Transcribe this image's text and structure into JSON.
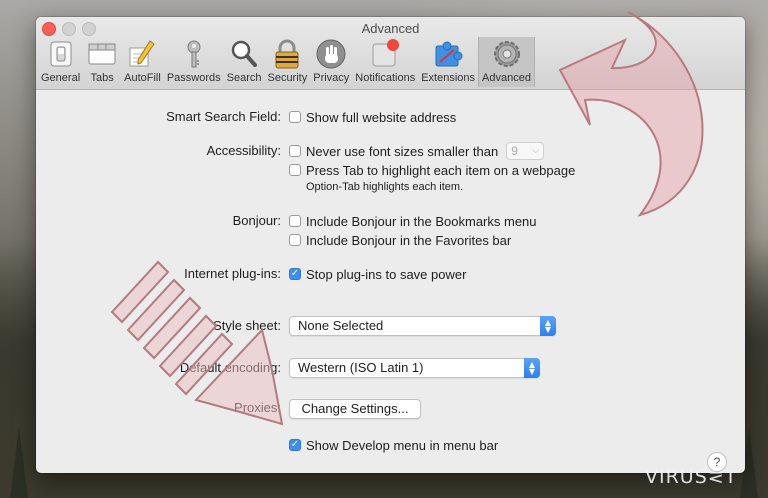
{
  "window": {
    "title": "Advanced"
  },
  "toolbar": {
    "items": [
      {
        "label": "General",
        "icon": "general-switch-icon"
      },
      {
        "label": "Tabs",
        "icon": "tabs-icon"
      },
      {
        "label": "AutoFill",
        "icon": "pencil-form-icon"
      },
      {
        "label": "Passwords",
        "icon": "key-icon"
      },
      {
        "label": "Search",
        "icon": "magnifier-icon"
      },
      {
        "label": "Security",
        "icon": "padlock-icon"
      },
      {
        "label": "Privacy",
        "icon": "hand-icon"
      },
      {
        "label": "Notifications",
        "icon": "notifications-icon"
      },
      {
        "label": "Extensions",
        "icon": "puzzle-icon"
      },
      {
        "label": "Advanced",
        "icon": "gear-icon"
      }
    ],
    "selected": "Advanced"
  },
  "settings": {
    "smart_search": {
      "label": "Smart Search Field:",
      "option": "Show full website address",
      "checked": false
    },
    "accessibility": {
      "label": "Accessibility:",
      "option1": "Never use font sizes smaller than",
      "font_size": "9",
      "option2": "Press Tab to highlight each item on a webpage",
      "note": "Option-Tab highlights each item."
    },
    "bonjour": {
      "label": "Bonjour:",
      "option1": "Include Bonjour in the Bookmarks menu",
      "option2": "Include Bonjour in the Favorites bar"
    },
    "plugins": {
      "label": "Internet plug-ins:",
      "option": "Stop plug-ins to save power",
      "checked": true
    },
    "style_sheet": {
      "label": "Style sheet:",
      "value": "None Selected"
    },
    "encoding": {
      "label": "Default encoding:",
      "value": "Western (ISO Latin 1)"
    },
    "proxies": {
      "label": "Proxies:",
      "button": "Change Settings..."
    },
    "develop": {
      "option": "Show Develop menu in menu bar",
      "checked": true
    }
  },
  "help": "?",
  "watermark": "VIRUS⋜T",
  "colors": {
    "accent": "#3a8ff5",
    "close": "#fc5f57",
    "arrow": "#d9a5a8"
  }
}
